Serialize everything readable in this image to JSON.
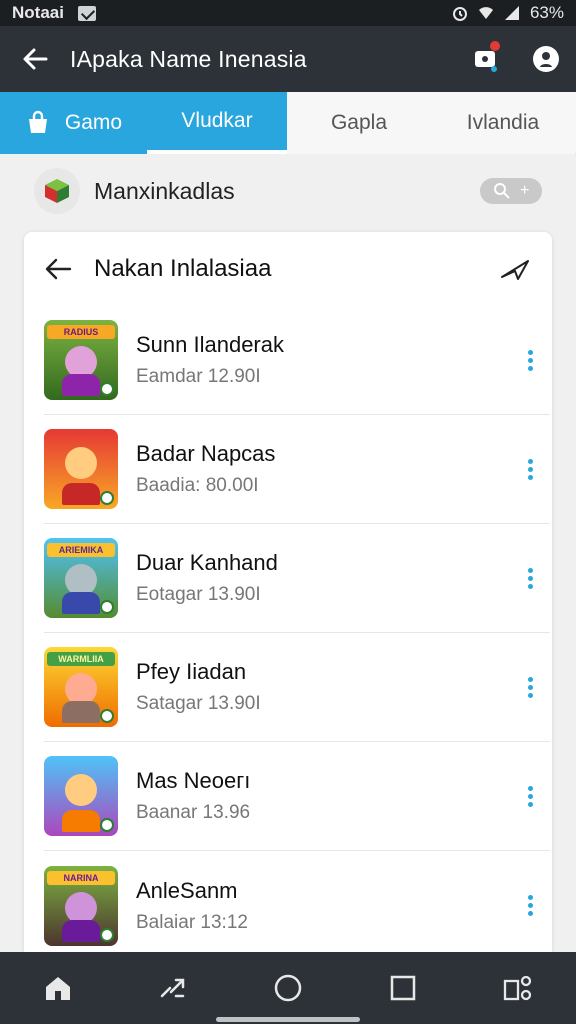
{
  "status_bar": {
    "carrier": "Notaai",
    "battery": "63%"
  },
  "app_bar": {
    "title": "IApaka Name Inenasia"
  },
  "tabs": [
    {
      "label": "Gamo"
    },
    {
      "label": "Vludkar"
    },
    {
      "label": "Gapla"
    },
    {
      "label": "Ivlandia"
    }
  ],
  "filter": {
    "label": "Manxinkadlas"
  },
  "card": {
    "title": "Nakan Inlalasiaa",
    "items": [
      {
        "name": "Sunn Ilanderak",
        "subtitle": "Eamdar 12.90I",
        "banner": "RADIUS"
      },
      {
        "name": "Badar Napcas",
        "subtitle": "Baadia: 80.00I",
        "banner": ""
      },
      {
        "name": "Duar Kanhand",
        "subtitle": "Eotagar 13.90I",
        "banner": "ARIEMIKA"
      },
      {
        "name": "Pfey Iiadan",
        "subtitle": "Satagar 13.90I",
        "banner": "WARMLIIA"
      },
      {
        "name": "Mas Neoeгı",
        "subtitle": "Baanar 13.96",
        "banner": ""
      },
      {
        "name": "AnleSanm",
        "subtitle": "Balaiar 13:12",
        "banner": "NARINA"
      }
    ]
  },
  "colors": {
    "accent": "#2aa6df",
    "app_bar": "#2c3237",
    "status_bar": "#1c1f22"
  },
  "icons": [
    "back-arrow-icon",
    "notification-icon",
    "account-icon",
    "bag-icon",
    "search-icon",
    "share-icon",
    "more-vert-icon",
    "home-icon",
    "recents-icon",
    "circle-home-icon",
    "square-icon",
    "apps-icon"
  ]
}
